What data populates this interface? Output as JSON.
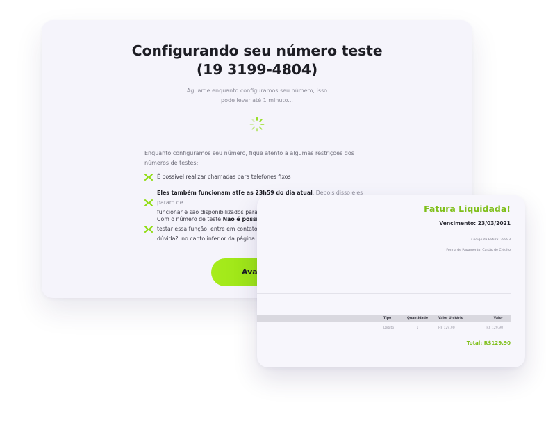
{
  "setup": {
    "title_line1": "Configurando seu número teste",
    "title_line2": "(19 3199-4804)",
    "subtitle": "Aguarde enquanto configuramos seu número, isso pode levar até 1 minuto...",
    "intro": "Enquanto configuramos seu número, fique atento à algumas restrições dos números de testes:",
    "rules": [
      {
        "text": "É possível realizar chamadas para telefones fixos"
      },
      {
        "bold": "Eles também funcionam at[e as 23h59 do dia atual",
        "text": ". Depois disso eles param de",
        "text2": "funcionar e são disponibilizados para outr"
      },
      {
        "text": "Com o número de teste ",
        "bold": "Não é possível c",
        "text2": "testar essa função, entre em contato com",
        "text3": "dúvida?' no canto inferior da página."
      }
    ],
    "button_label": "Avançar",
    "accent_color": "#8fdc10"
  },
  "invoice": {
    "title": "Fatura Liquidada!",
    "due": "Vencimento: 23/03/2021",
    "code": "Código da Fatura: 29993",
    "payment": "Forma de Pagamento: Cartão de Crédito",
    "table": {
      "headers": [
        "Tipo",
        "Quantidade",
        "Valor Unitário",
        "Valor"
      ],
      "rows": [
        [
          "Débito",
          "1",
          "R$ 129,90",
          "R$ 129,90"
        ]
      ]
    },
    "total": "Total: R$129,90",
    "accent_color": "#7fbf1a"
  }
}
